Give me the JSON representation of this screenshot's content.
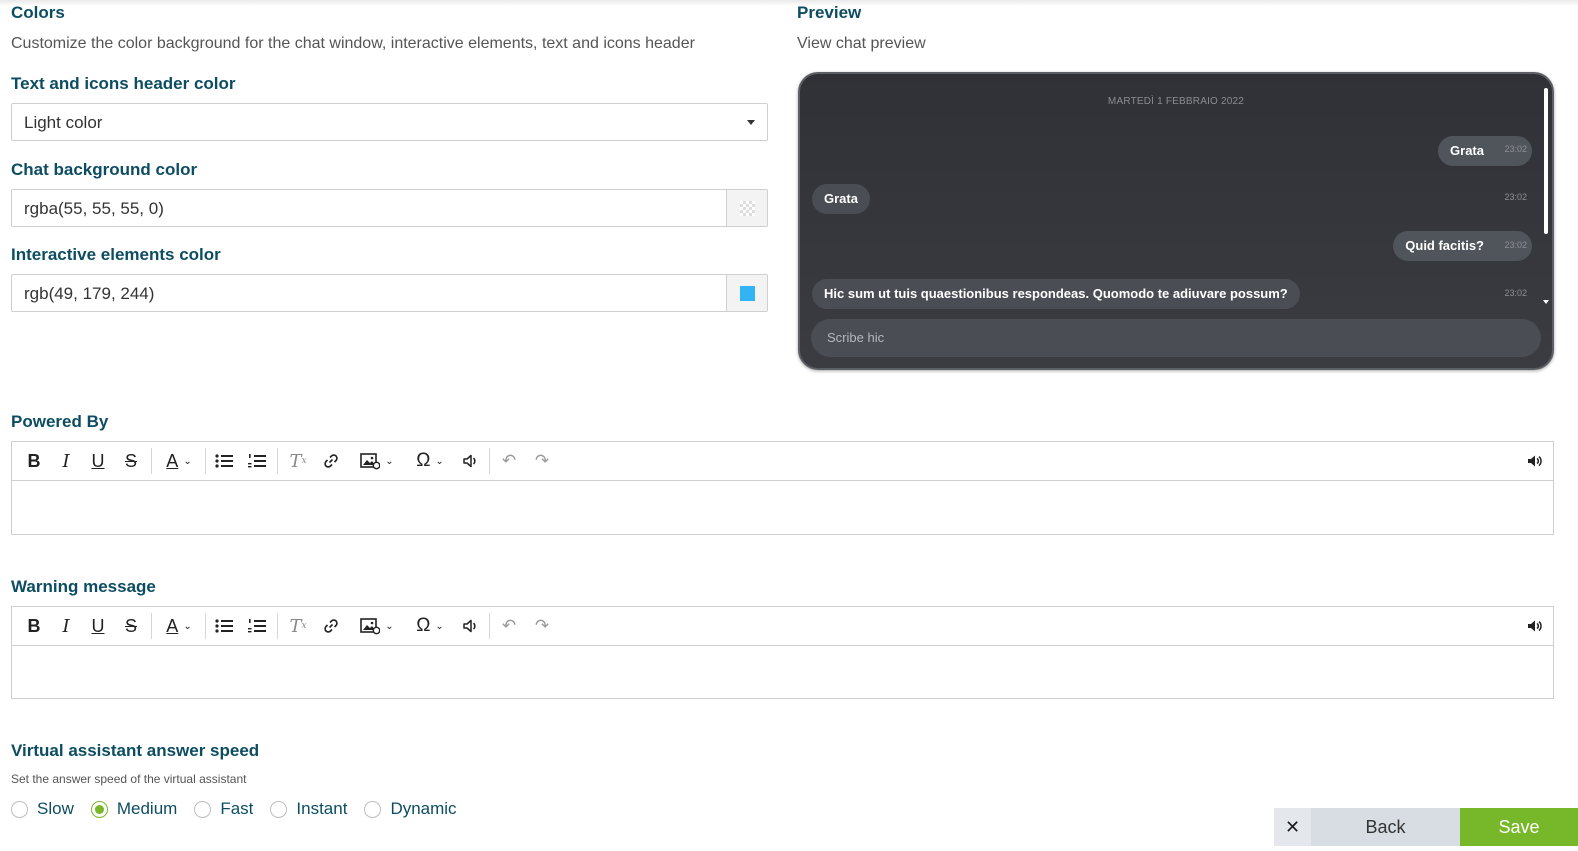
{
  "colors": {
    "title": "Colors",
    "subtitle": "Customize the color background for the chat window, interactive elements, text and icons header",
    "header_color_label": "Text and icons header color",
    "header_color_value": "Light color",
    "chat_bg_label": "Chat background color",
    "chat_bg_value": "rgba(55, 55, 55, 0)",
    "interactive_label": "Interactive elements color",
    "interactive_value": "rgb(49, 179, 244)",
    "interactive_swatch": "#31b3f4"
  },
  "preview": {
    "title": "Preview",
    "subtitle": "View chat preview",
    "date": "MARTEDÌ 1 FEBBRAIO 2022",
    "messages": [
      {
        "side": "out",
        "text": "Grata",
        "time": "23:02"
      },
      {
        "side": "in",
        "text": "Grata",
        "time": "23:02"
      },
      {
        "side": "out",
        "text": "Quid facitis?",
        "time": "23:02"
      },
      {
        "side": "in",
        "text": "Hic sum ut tuis quaestionibus respondeas. Quomodo te adiuvare possum?",
        "time": "23:02"
      }
    ],
    "composer_placeholder": "Scribe hic"
  },
  "powered_by": {
    "label": "Powered By"
  },
  "warning": {
    "label": "Warning message"
  },
  "speed": {
    "title": "Virtual assistant answer speed",
    "subtitle": "Set the answer speed of the virtual assistant",
    "options": [
      "Slow",
      "Medium",
      "Fast",
      "Instant",
      "Dynamic"
    ],
    "selected": "Medium"
  },
  "footer": {
    "close": "✕",
    "back": "Back",
    "save": "Save"
  },
  "theme": {
    "accent": "#77b82a",
    "heading": "#0d4d62"
  }
}
